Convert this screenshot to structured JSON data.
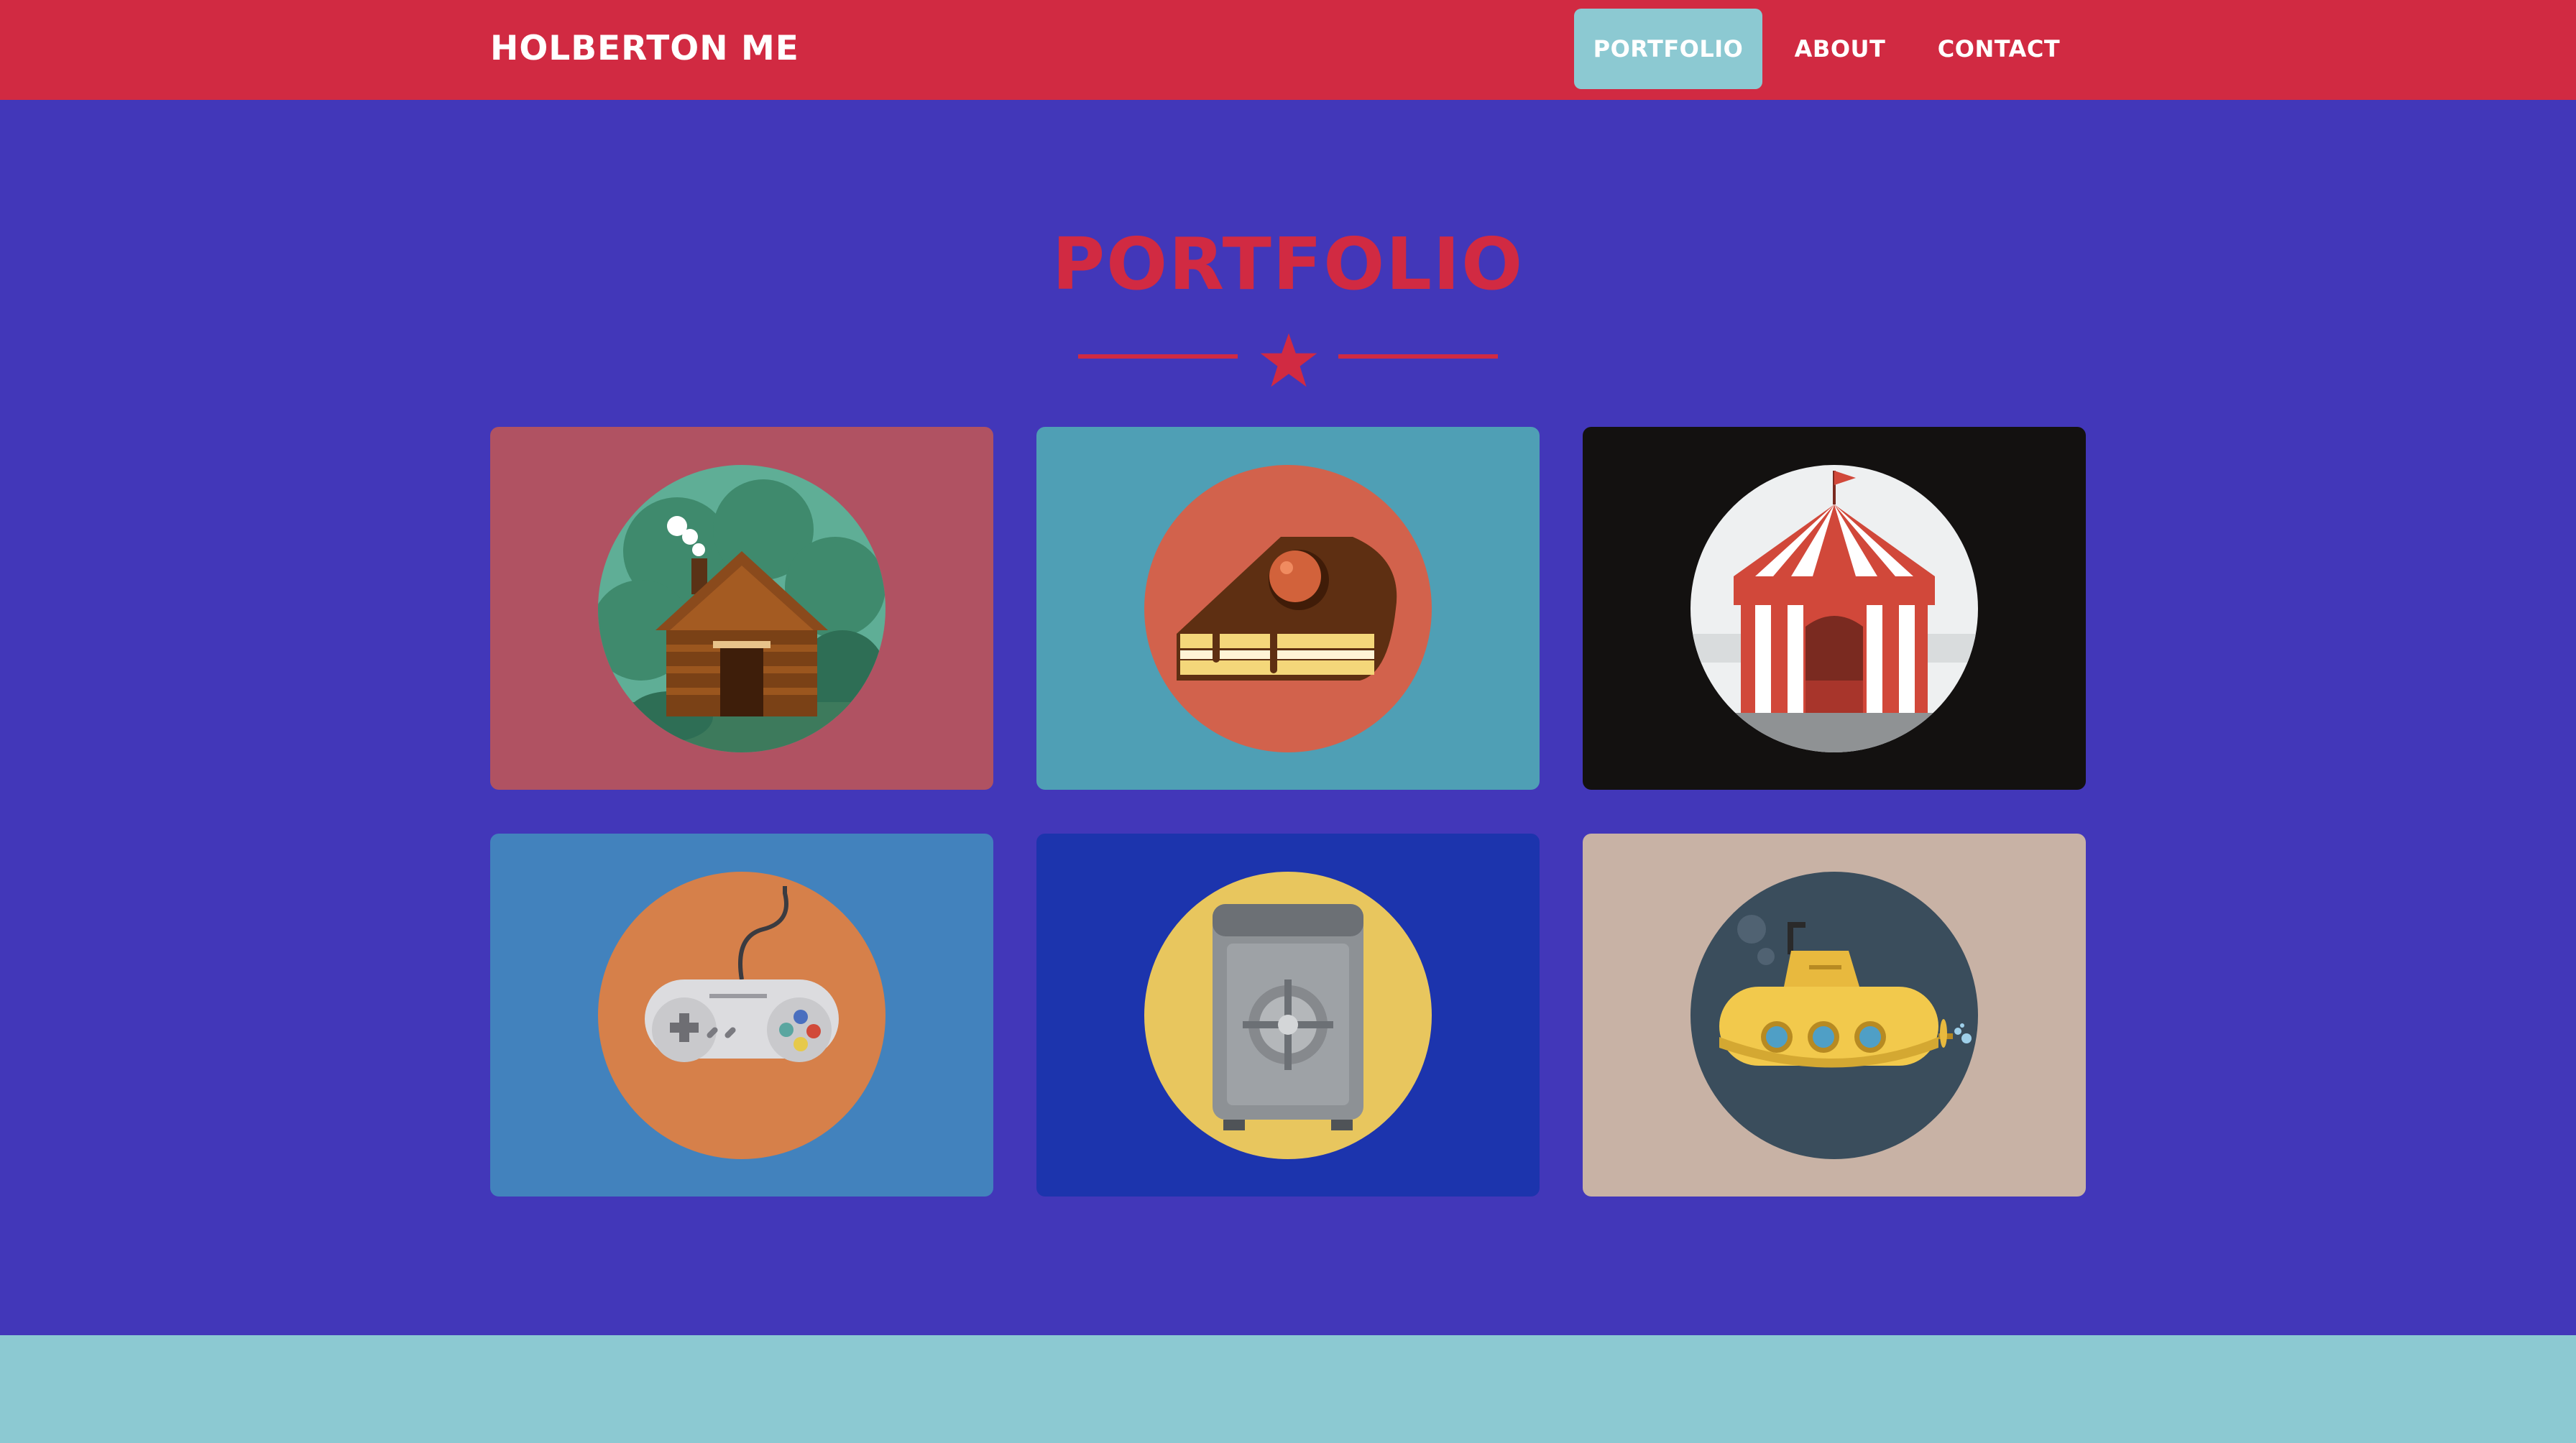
{
  "navbar": {
    "brand": "HOLBERTON ME",
    "links": [
      {
        "label": "PORTFOLIO",
        "active": true
      },
      {
        "label": "ABOUT",
        "active": false
      },
      {
        "label": "CONTACT",
        "active": false
      }
    ],
    "colors": {
      "bar": "#d12a42",
      "active": "#8cc9d2",
      "text": "#ffffff"
    }
  },
  "portfolio": {
    "title": "PORTFOLIO",
    "divider_icon": "star-icon",
    "items": [
      {
        "icon": "log-cabin-icon",
        "background": "#b05262"
      },
      {
        "icon": "cake-slice-icon",
        "background": "#4f9fb5"
      },
      {
        "icon": "circus-tent-icon",
        "background": "#131110"
      },
      {
        "icon": "game-controller-icon",
        "background": "#4282bd"
      },
      {
        "icon": "safe-icon",
        "background": "#1c34ad"
      },
      {
        "icon": "submarine-icon",
        "background": "#c8b2a5"
      }
    ]
  },
  "colors": {
    "page": "#4237b9",
    "footer": "#8cc9d2"
  }
}
